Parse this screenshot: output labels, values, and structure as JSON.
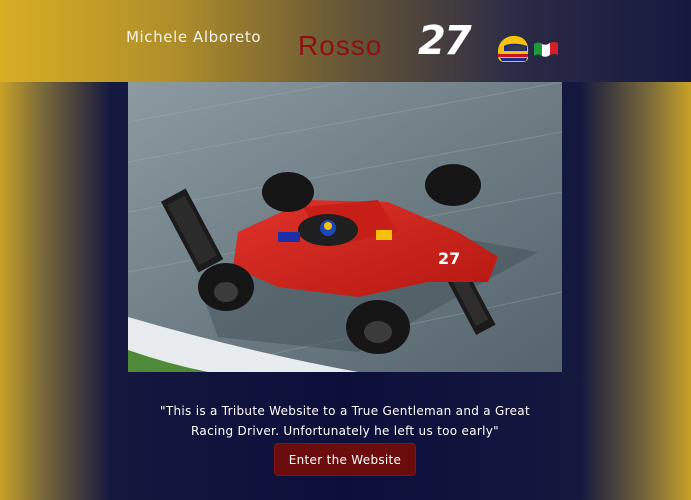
{
  "header": {
    "driver_name": "Michele Alboreto",
    "brand_word": "Rosso",
    "brand_number": "27",
    "helmet_icon": "helmet-icon",
    "flag_icon": "italy-flag-icon",
    "colors": {
      "brand_red": "#8e1010",
      "gold": "#d8ae24",
      "navy": "#0c0f3a"
    }
  },
  "hero": {
    "image": "ferrari-f1-car-photo"
  },
  "main": {
    "tagline_line1": "\"This is a Tribute Website to a True Gentleman and a Great",
    "tagline_line2": "Racing Driver. Unfortunately he left us too early\"",
    "enter_button": "Enter the Website"
  }
}
